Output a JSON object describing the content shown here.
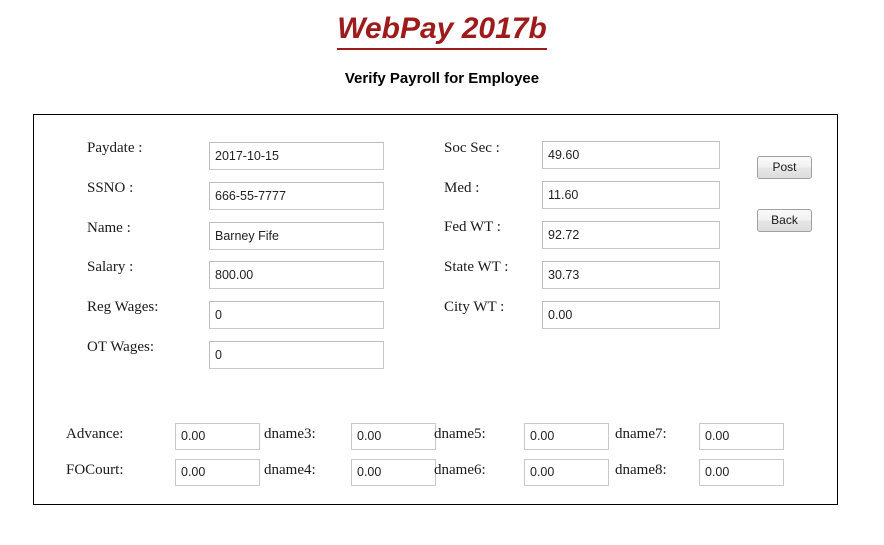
{
  "header": {
    "app_title": "WebPay 2017b",
    "subtitle": "Verify Payroll for Employee"
  },
  "form": {
    "left_fields": [
      {
        "label": "Paydate :",
        "value": "2017-10-15"
      },
      {
        "label": "SSNO    :",
        "value": "666-55-7777"
      },
      {
        "label": "Name    :",
        "value": "Barney  Fife"
      },
      {
        "label": "Salary   :",
        "value": "800.00"
      },
      {
        "label": "Reg Wages:",
        "value": "0"
      },
      {
        "label": "OT Wages:",
        "value": "0"
      }
    ],
    "right_fields": [
      {
        "label": "Soc Sec  :",
        "value": "49.60"
      },
      {
        "label": "Med       :",
        "value": "11.60"
      },
      {
        "label": "Fed WT  :",
        "value": "92.72"
      },
      {
        "label": "State WT :",
        "value": "30.73"
      },
      {
        "label": "City WT  :",
        "value": "0.00"
      }
    ],
    "deductions": [
      {
        "label": "Advance:",
        "value": "0.00"
      },
      {
        "label": "FOCourt:",
        "value": "0.00"
      },
      {
        "label": "dname3:",
        "value": "0.00"
      },
      {
        "label": "dname4:",
        "value": "0.00"
      },
      {
        "label": "dname5:",
        "value": "0.00"
      },
      {
        "label": "dname6:",
        "value": "0.00"
      },
      {
        "label": "dname7:",
        "value": "0.00"
      },
      {
        "label": "dname8:",
        "value": "0.00"
      }
    ],
    "buttons": [
      {
        "label": "Post"
      },
      {
        "label": "Back"
      }
    ]
  },
  "colors": {
    "title_red": "#9e1b1b",
    "frame_border": "#000000",
    "input_border": "#c9c9c9"
  }
}
